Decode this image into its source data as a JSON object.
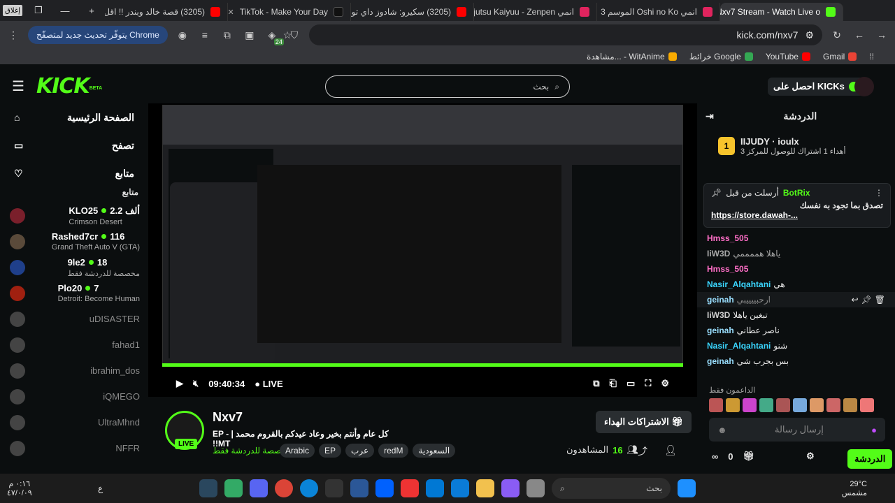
{
  "browser": {
    "tabs": [
      {
        "label": "(3205) قصة خالد وبندر !! اقل...",
        "color": "#ff0000"
      },
      {
        "label": "TikTok - Make Your Day",
        "color": "#111111"
      },
      {
        "label": "(3205) سكيرو: شادوز داي توا...",
        "color": "#ff0000"
      },
      {
        "label": "انمي Jujutsu Kaiyuu - Zenpen",
        "color": "#e0245e"
      },
      {
        "label": "انمي Oshi no Ko الموسم 3",
        "color": "#e0245e"
      },
      {
        "label": "Nxv7 Stream - Watch Live o...",
        "color": "#53fc18",
        "active": true
      }
    ],
    "update_label": "يتوفّر تحديث جديد لمتصفّح Chrome",
    "url": "kick.com/nxv7",
    "extension_badge": "24",
    "bookmarks": [
      {
        "label": "Gmail",
        "color": "#ea4335"
      },
      {
        "label": "YouTube",
        "color": "#ff0000"
      },
      {
        "label": "خرائط Google",
        "color": "#34a853"
      },
      {
        "label": "مشاهدة... - WitAnime",
        "color": "#f9ab00"
      }
    ],
    "close_hint": "إغلاق"
  },
  "kick": {
    "logo": "KICK",
    "logo_beta": "BETA",
    "search_placeholder": "بحث",
    "get_kicks": "احصل على KICKs",
    "nav": [
      {
        "label": "الصفحة الرئيسية",
        "icon": "home-icon"
      },
      {
        "label": "تصفح",
        "icon": "browse-icon"
      },
      {
        "label": "متابع",
        "icon": "heart-icon"
      }
    ],
    "following_header": "متابع",
    "channels": [
      {
        "name": "KLO25",
        "count": "2.2 ألف",
        "game": "Crimson Desert",
        "live": true,
        "color": "#7a1f2b"
      },
      {
        "name": "Rashed7cr",
        "count": "116",
        "game": "Grand Theft Auto V (GTA)",
        "live": true,
        "color": "#5a4a3a"
      },
      {
        "name": "9le2",
        "count": "18",
        "game": "مخصصة للدردشة فقط",
        "live": true,
        "color": "#1f3f8a"
      },
      {
        "name": "Plo20",
        "count": "7",
        "game": "Detroit: Become Human",
        "live": true,
        "color": "#a02010"
      },
      {
        "name": "uDISASTER",
        "live": false,
        "color": "#444444"
      },
      {
        "name": "fahad1",
        "live": false,
        "color": "#333333"
      },
      {
        "name": "ibrahim_dos",
        "live": false,
        "color": "#3a3a3a"
      },
      {
        "name": "iQMEGO",
        "live": false,
        "color": "#2a2a2a"
      },
      {
        "name": "UltraMhnd",
        "live": false,
        "color": "#555555"
      },
      {
        "name": "NFFR",
        "live": false,
        "color": "#333333"
      }
    ],
    "player": {
      "time": "09:40:34",
      "live_label": "LIVE"
    },
    "stream": {
      "name": "Nxv7",
      "title": "كل عام وأنتم بخير وعاد عيدكم بالقروم محمد | EP - !MT!",
      "category": "مخصصة للدردشة فقط",
      "tags": [
        "السعودية",
        "redM",
        "عرب",
        "EP",
        "Arabic"
      ],
      "viewers_label": "المشاهدون",
      "viewers": "16",
      "live_badge": "LIVE",
      "sub_gift_button": "الاشتراكات الهداء"
    },
    "chat": {
      "header": "الدردشة",
      "gift_card": {
        "gifter": "IIJUDY",
        "badge_count": "1",
        "recipient": "ioulx",
        "text": "أهداء 1 اشتراك للوصول للمركز 3"
      },
      "pinned": {
        "header": "أرسلت من قبل",
        "user": "BotRix",
        "text": "تصدق بما تجود به نفسك",
        "link": "https://store.dawah-..."
      },
      "messages": [
        {
          "user": "Hmss_505",
          "text": "",
          "color": "#ff6ec7"
        },
        {
          "user": "IiW3D",
          "text": "ياهلا هممممي",
          "color": "#cfcfcf"
        },
        {
          "user": "Hmss_505",
          "text": "",
          "color": "#ff6ec7"
        },
        {
          "user": "Nasir_Alqahtani",
          "text": "هي",
          "color": "#3ad6ff"
        },
        {
          "user": "geinah",
          "text": "ارحبييييبي",
          "color": "#9adfff"
        },
        {
          "user": "IiW3D",
          "text": "تبغين ياهلا",
          "color": "#cfcfcf"
        },
        {
          "user": "geinah",
          "text": "ناصر عطاني",
          "color": "#9adfff"
        },
        {
          "user": "Nasir_Alqahtani",
          "text": "شنو",
          "color": "#3ad6ff"
        },
        {
          "user": "geinah",
          "text": "بس بجرب شي",
          "color": "#9adfff"
        }
      ],
      "supporters_label": "الداعمون فقط",
      "input_placeholder": "إرسال رسالة",
      "send_button": "الدردشة",
      "count": "0"
    }
  },
  "taskbar": {
    "weather": "29°C",
    "weather_desc": "مشمس",
    "search": "بحث",
    "time": "٠:١٦ م",
    "date": "٤٧/٠/٠٩",
    "lang": "ع"
  }
}
